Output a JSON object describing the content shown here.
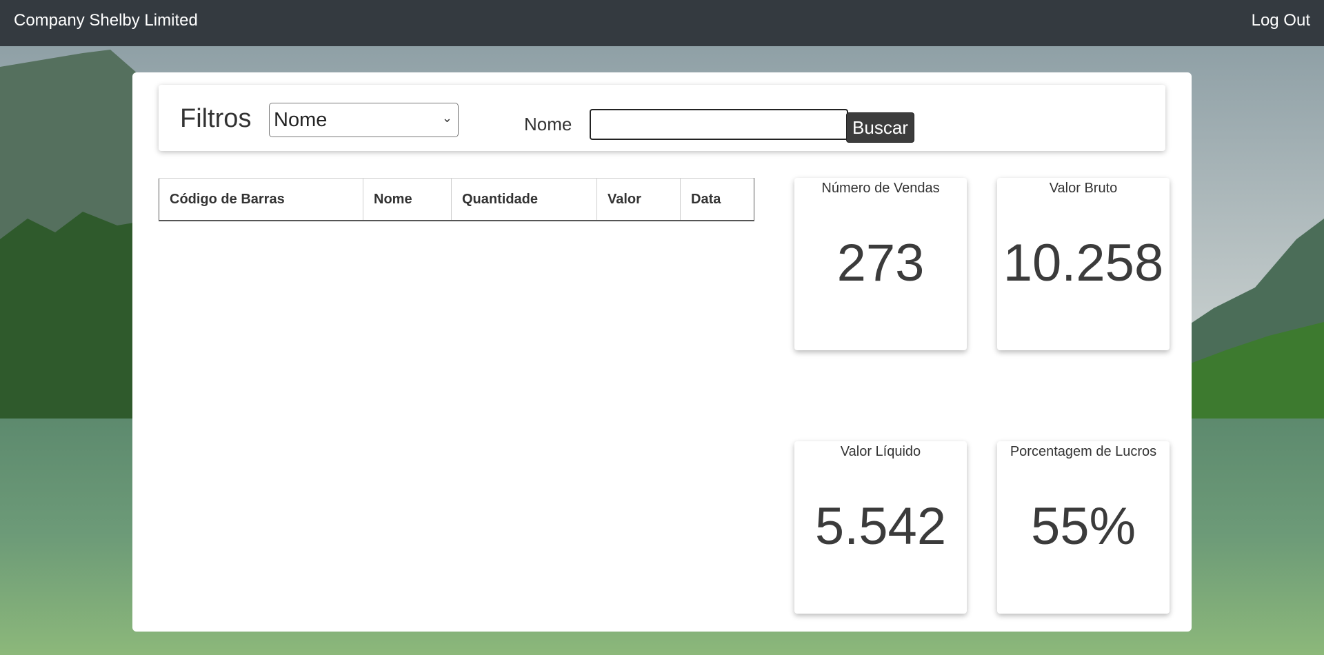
{
  "navbar": {
    "brand": "Company Shelby Limited",
    "logout": "Log Out"
  },
  "filters": {
    "title": "Filtros",
    "select_value": "Nome",
    "name_label": "Nome",
    "name_input_value": "",
    "search_button": "Buscar"
  },
  "table": {
    "columns": [
      "Código de Barras",
      "Nome",
      "Quantidade",
      "Valor",
      "Data"
    ],
    "rows": []
  },
  "cards": [
    {
      "title": "Número de Vendas",
      "value": "273"
    },
    {
      "title": "Valor Bruto",
      "value": "10.258"
    },
    {
      "title": "Valor Líquido",
      "value": "5.542"
    },
    {
      "title": "Porcentagem de Lucros",
      "value": "55%"
    }
  ]
}
